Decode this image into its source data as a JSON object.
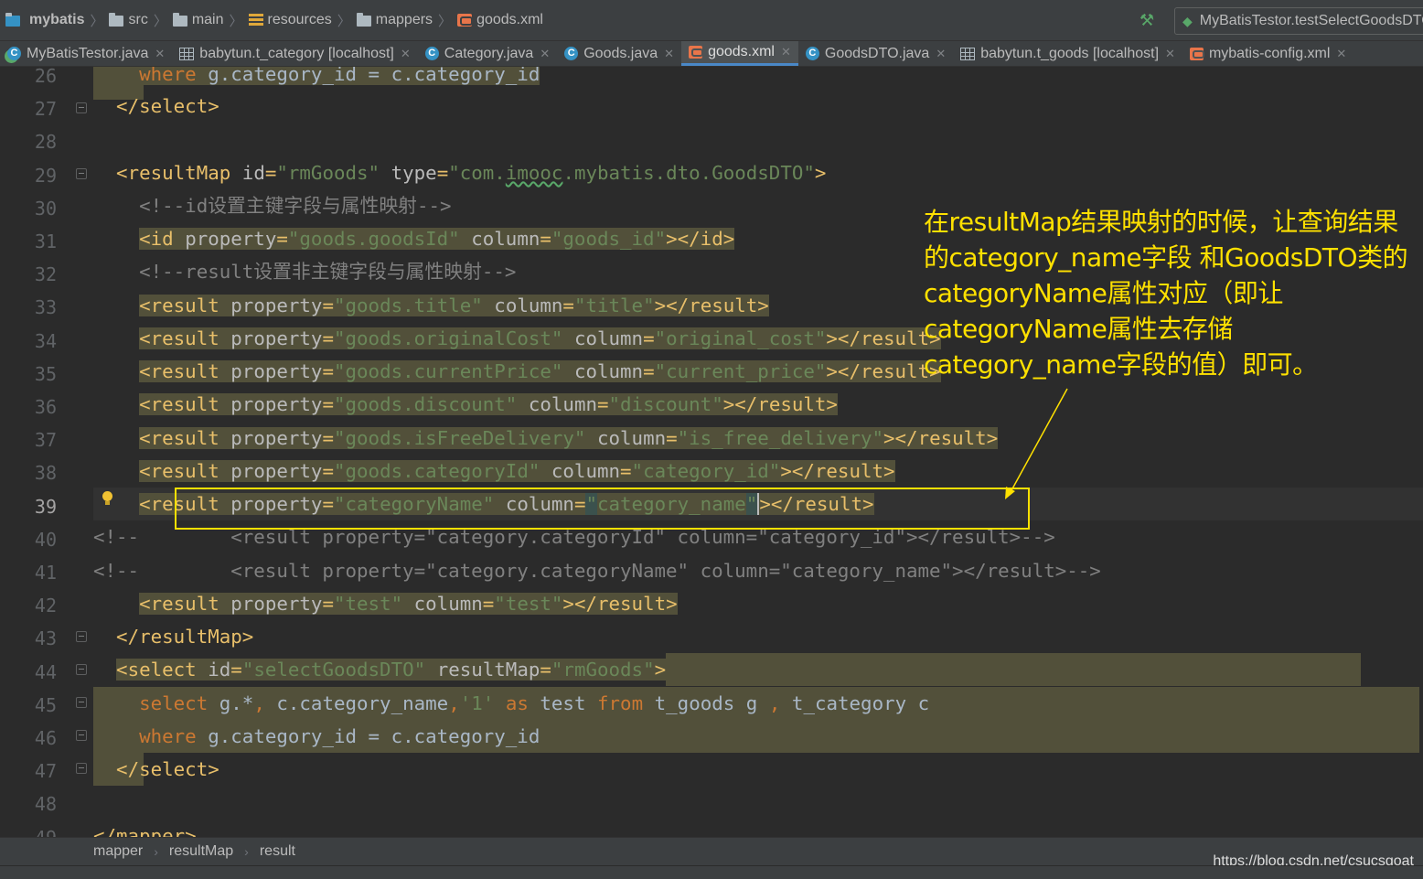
{
  "breadcrumb": [
    "mybatis",
    "src",
    "main",
    "resources",
    "mappers",
    "goods.xml"
  ],
  "run_config": "MyBatisTestor.testSelectGoodsDTO",
  "tabs": [
    {
      "label": "MyBatisTestor.java",
      "icon": "java-class-icon",
      "active": false
    },
    {
      "label": "babytun.t_category [localhost]",
      "icon": "table-icon",
      "active": false
    },
    {
      "label": "Category.java",
      "icon": "java-class-icon",
      "active": false
    },
    {
      "label": "Goods.java",
      "icon": "java-class-icon",
      "active": false
    },
    {
      "label": "goods.xml",
      "icon": "xml-file-icon",
      "active": true
    },
    {
      "label": "GoodsDTO.java",
      "icon": "java-class-icon",
      "active": false
    },
    {
      "label": "babytun.t_goods [localhost]",
      "icon": "table-icon",
      "active": false
    },
    {
      "label": "mybatis-config.xml",
      "icon": "xml-file-icon",
      "active": false
    }
  ],
  "editor": {
    "current_line": 39,
    "line_numbers": [
      "26",
      "27",
      "28",
      "29",
      "30",
      "31",
      "32",
      "33",
      "34",
      "35",
      "36",
      "37",
      "38",
      "39",
      "40",
      "41",
      "42",
      "43",
      "44",
      "45",
      "46",
      "47",
      "48",
      "49"
    ]
  },
  "annotation": {
    "text": "在resultMap结果映射的时候，让查询结果的category_name字段  和GoodsDTO类的categoryName属性对应（即让categoryName属性去存储category_name字段的值）即可。",
    "color": "#ffe100"
  },
  "status_breadcrumb": [
    "mapper",
    "resultMap",
    "result"
  ],
  "watermark": "https://blog.csdn.net/csucsgoat"
}
